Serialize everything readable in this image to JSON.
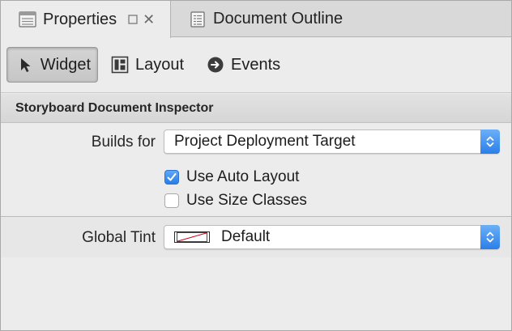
{
  "tabs": {
    "properties_label": "Properties",
    "outline_label": "Document Outline"
  },
  "subnav": {
    "widget_label": "Widget",
    "layout_label": "Layout",
    "events_label": "Events"
  },
  "section": {
    "title": "Storyboard Document Inspector"
  },
  "builds_for": {
    "label": "Builds for",
    "value": "Project Deployment Target"
  },
  "options": [
    {
      "label": "Use Auto Layout",
      "checked": true
    },
    {
      "label": "Use Size Classes",
      "checked": false
    }
  ],
  "global_tint": {
    "label": "Global Tint",
    "value": "Default"
  },
  "colors": {
    "accent": "#2a7fe8",
    "tab_bar_bg": "#d9d9d9",
    "panel_bg": "#ececec"
  }
}
